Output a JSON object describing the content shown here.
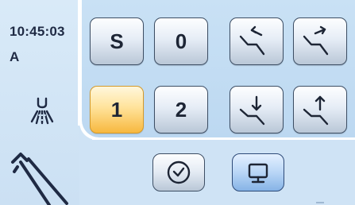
{
  "status": {
    "time": "10:45:03",
    "mode_letter": "A"
  },
  "program_buttons": {
    "s_label": "S",
    "zero_label": "0",
    "one_label": "1",
    "two_label": "2",
    "active": "1"
  },
  "chair_buttons": {
    "recline_back_icon": "backrest-recline-back-icon",
    "recline_forward_icon": "backrest-recline-forward-icon",
    "seat_down_icon": "seat-down-icon",
    "seat_up_icon": "seat-up-icon"
  },
  "bottom_buttons": {
    "timer_icon": "clock-icon",
    "monitor_icon": "monitor-icon",
    "monitor_active": true
  },
  "colors": {
    "panel_blue": "#c9e1f5",
    "active_orange": "#f7b83f",
    "text_dark": "#1f2a44"
  }
}
